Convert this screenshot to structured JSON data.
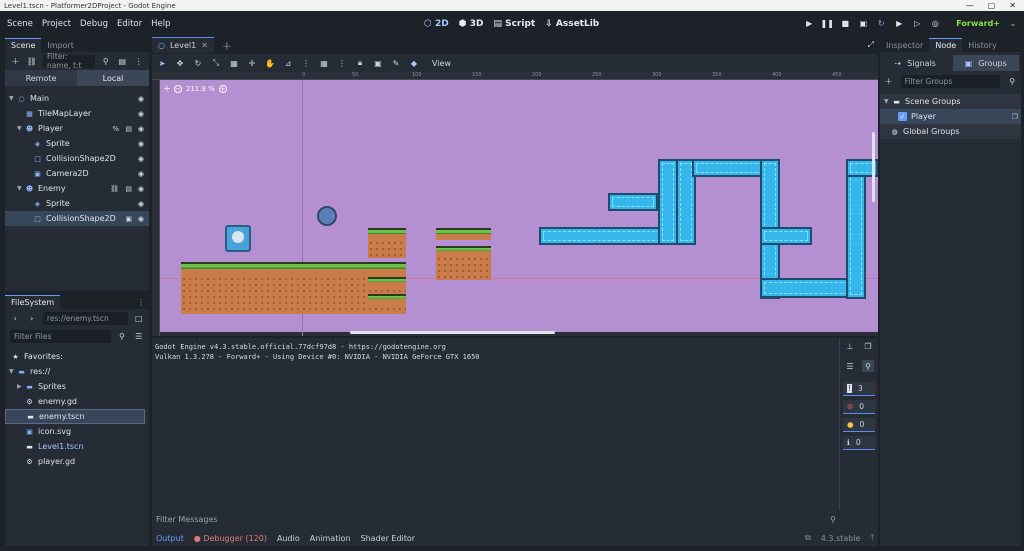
{
  "window": {
    "title": "Level1.tscn - Platformer2DProject - Godot Engine"
  },
  "menu": [
    "Scene",
    "Project",
    "Debug",
    "Editor",
    "Help"
  ],
  "workspaces": {
    "w2d": "2D",
    "w3d": "3D",
    "script": "Script",
    "assetlib": "AssetLib"
  },
  "renderer": "Forward+",
  "left_dock": {
    "tabs": [
      "Scene",
      "Import"
    ],
    "filter_placeholder": "Filter: name, t:t",
    "remote": "Remote",
    "local": "Local",
    "tree": [
      {
        "label": "Main",
        "depth": 0,
        "icon": "node2d-icon"
      },
      {
        "label": "TileMapLayer",
        "depth": 1,
        "icon": "tilemap-icon"
      },
      {
        "label": "Player",
        "depth": 1,
        "icon": "character-icon"
      },
      {
        "label": "Sprite",
        "depth": 2,
        "icon": "sprite-icon"
      },
      {
        "label": "CollisionShape2D",
        "depth": 2,
        "icon": "collision-icon"
      },
      {
        "label": "Camera2D",
        "depth": 2,
        "icon": "camera-icon"
      },
      {
        "label": "Enemy",
        "depth": 1,
        "icon": "character-icon"
      },
      {
        "label": "Sprite",
        "depth": 2,
        "icon": "sprite-icon"
      },
      {
        "label": "CollisionShape2D",
        "depth": 2,
        "icon": "collision-icon"
      }
    ]
  },
  "filesystem": {
    "tab": "FileSystem",
    "path": "res://enemy.tscn",
    "filter_placeholder": "Filter Files",
    "favorites": "Favorites:",
    "root": "res://",
    "items": [
      {
        "label": "Sprites",
        "type": "folder"
      },
      {
        "label": "enemy.gd",
        "type": "script"
      },
      {
        "label": "enemy.tscn",
        "type": "scene"
      },
      {
        "label": "icon.svg",
        "type": "image"
      },
      {
        "label": "Level1.tscn",
        "type": "scene"
      },
      {
        "label": "player.gd",
        "type": "script"
      }
    ]
  },
  "editor": {
    "scene_tab": "Level1",
    "view_menu": "View",
    "zoom": "211.9 %",
    "ruler_labels": [
      "0",
      "50",
      "100",
      "150",
      "200",
      "250",
      "300",
      "350",
      "400",
      "450",
      "500",
      "550",
      "600"
    ]
  },
  "output": {
    "lines": [
      "Godot Engine v4.3.stable.official.77dcf97d8 - https://godotengine.org",
      "Vulkan 1.3.278 - Forward+ - Using Device #0: NVIDIA - NVIDIA GeForce GTX 1650"
    ],
    "filter_placeholder": "Filter Messages",
    "counts": {
      "messages": "3",
      "errors": "0",
      "warnings": "0",
      "info": "0"
    },
    "bottom_tabs": [
      "Output",
      "Debugger (120)",
      "Audio",
      "Animation",
      "Shader Editor"
    ],
    "version": "4.3.stable"
  },
  "right_dock": {
    "tabs": [
      "Inspector",
      "Node",
      "History"
    ],
    "subtabs": {
      "signals": "Signals",
      "groups": "Groups"
    },
    "filter_placeholder": "Filter Groups",
    "scene_groups": "Scene Groups",
    "group_player": "Player",
    "global_groups": "Global Groups"
  },
  "colors": {
    "accent": "#5b8ef0",
    "viewport_bg": "#b48fd1",
    "pipe": "#35b7ec",
    "error": "#e05555",
    "warning": "#f0c24b"
  }
}
